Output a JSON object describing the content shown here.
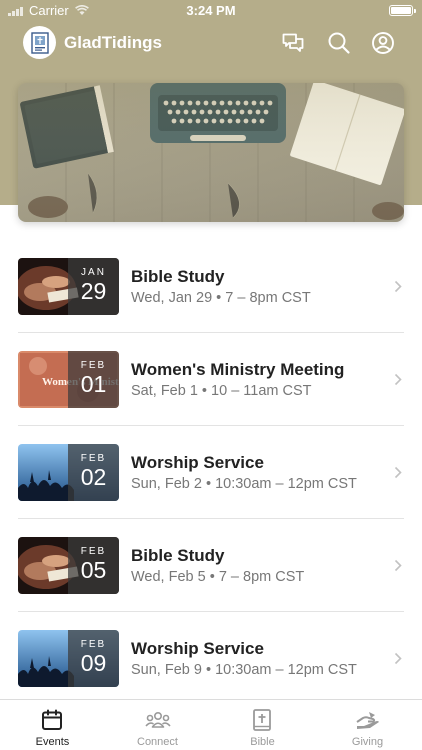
{
  "status_bar": {
    "carrier": "Carrier",
    "time": "3:24 PM"
  },
  "header": {
    "title": "GladTidings"
  },
  "events": [
    {
      "month": "JAN",
      "day": "29",
      "title": "Bible Study",
      "subtitle": "Wed, Jan 29 • 7 – 8pm CST",
      "image": "bible-hands"
    },
    {
      "month": "FEB",
      "day": "01",
      "title": "Women's Ministry Meeting",
      "subtitle": "Sat, Feb 1 • 10 – 11am CST",
      "image": "womens-ministry",
      "image_text": "Women's Minist"
    },
    {
      "month": "FEB",
      "day": "02",
      "title": "Worship Service",
      "subtitle": "Sun, Feb 2 • 10:30am – 12pm CST",
      "image": "worship-crowd"
    },
    {
      "month": "FEB",
      "day": "05",
      "title": "Bible Study",
      "subtitle": "Wed, Feb 5 • 7 – 8pm CST",
      "image": "bible-hands"
    },
    {
      "month": "FEB",
      "day": "09",
      "title": "Worship Service",
      "subtitle": "Sun, Feb 9 • 10:30am – 12pm CST",
      "image": "worship-crowd"
    }
  ],
  "tabs": [
    {
      "label": "Events",
      "icon": "calendar-icon",
      "active": true
    },
    {
      "label": "Connect",
      "icon": "people-icon",
      "active": false
    },
    {
      "label": "Bible",
      "icon": "bible-icon",
      "active": false
    },
    {
      "label": "Giving",
      "icon": "giving-hand-icon",
      "active": false
    }
  ],
  "colors": {
    "header_band": "#b5ad8a",
    "active_tab": "#222222",
    "inactive_tab": "#9a9a9a"
  }
}
